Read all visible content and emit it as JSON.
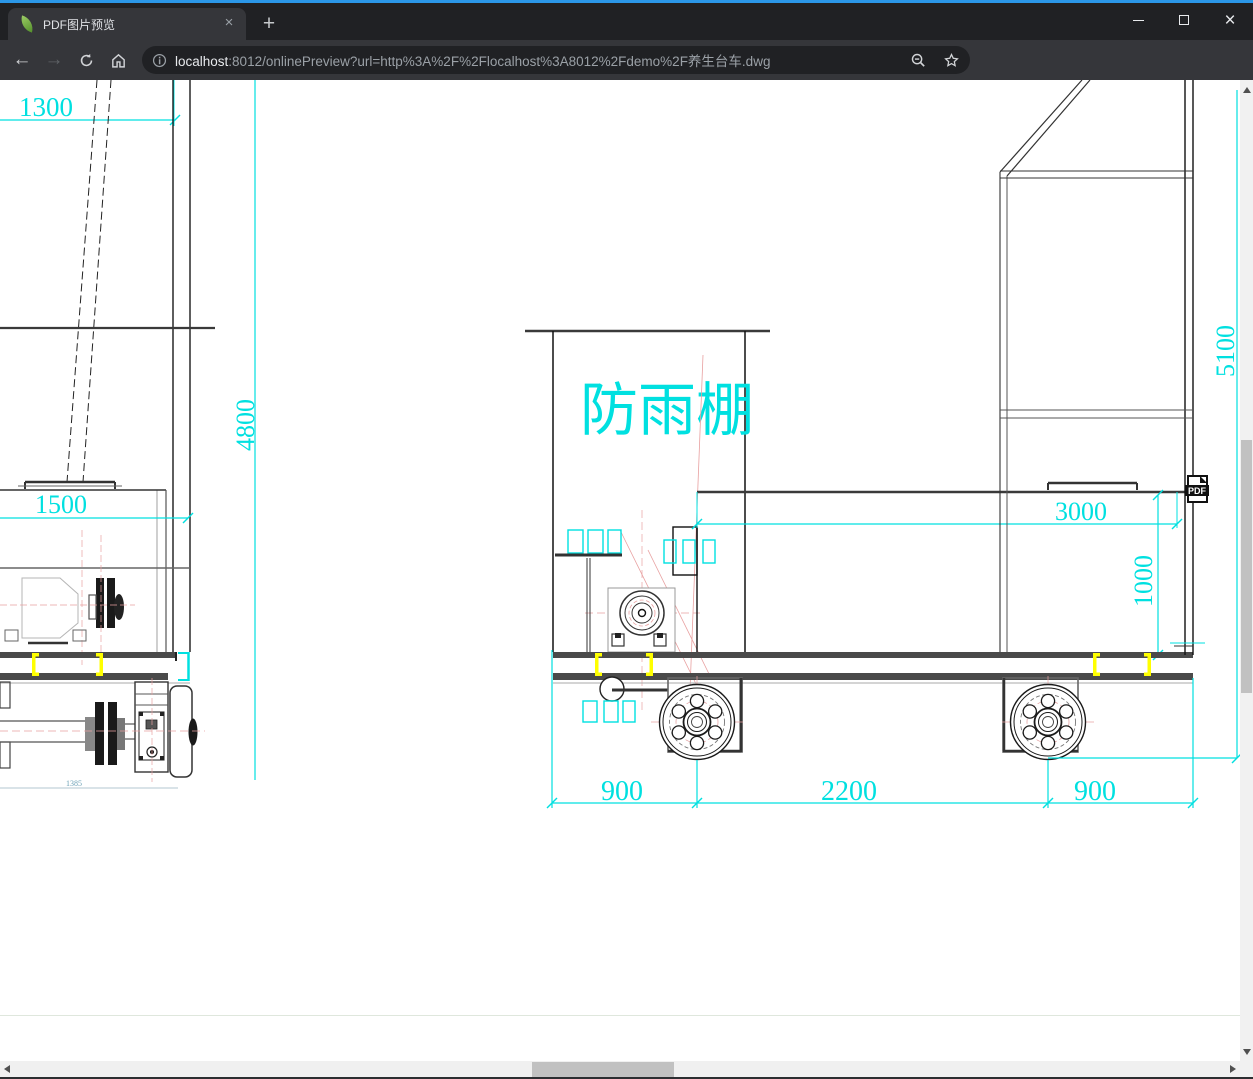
{
  "tab": {
    "title": "PDF图片预览",
    "close_glyph": "×",
    "new_tab_glyph": "+"
  },
  "window_controls": {
    "close_glyph": "×"
  },
  "toolbar": {
    "back_glyph": "←",
    "forward_glyph": "→",
    "url_host": "localhost",
    "url_rest": ":8012/onlinePreview?url=http%3A%2F%2Flocalhost%3A8012%2Fdemo%2F养生台车.dwg",
    "menu_glyph": "⋮"
  },
  "drawing": {
    "shelter_label": "防雨棚",
    "pdf_badge": "PDF",
    "dimensions": {
      "top_left_width": "1300",
      "left_height": "4800",
      "cabin_width": "1500",
      "axle_span": "1385",
      "platform_width": "3000",
      "platform_height": "1000",
      "overall_height": "5100",
      "left_wheel_offset": "900",
      "wheel_spacing": "2200",
      "right_wheel_offset": "900"
    },
    "colors": {
      "dimension": "#00e0e0",
      "highlight": "#ffff00",
      "centerline": "#e8a0a0"
    }
  }
}
